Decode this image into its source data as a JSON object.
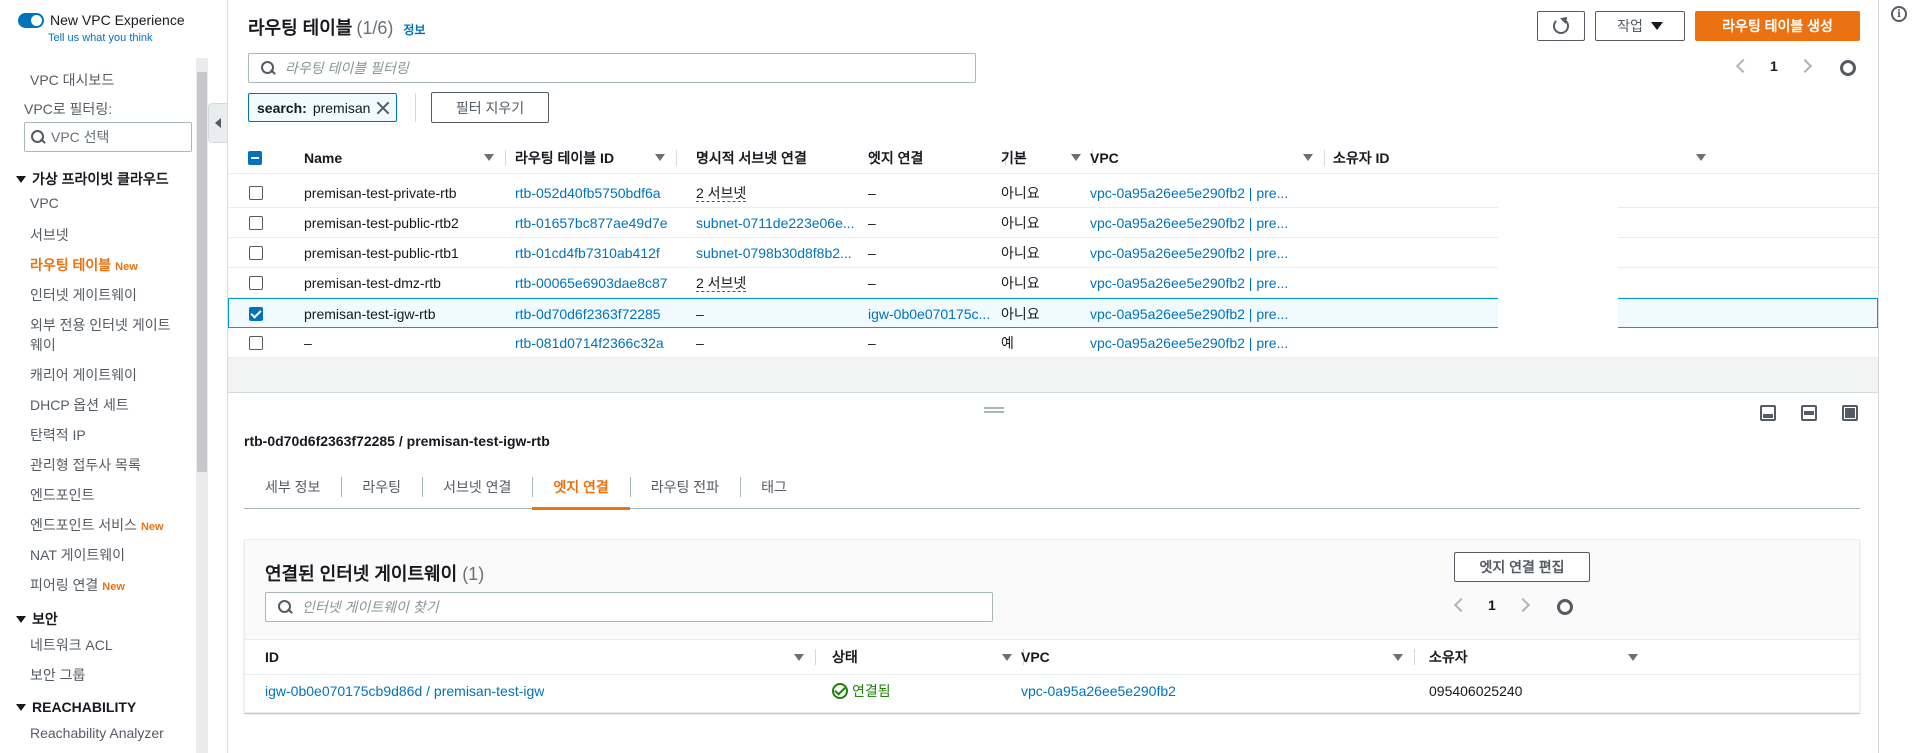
{
  "sidebar": {
    "experience_label": "New VPC Experience",
    "experience_sub": "Tell us what you think",
    "dashboard": "VPC 대시보드",
    "filter_label": "VPC로 필터링:",
    "filter_placeholder": "VPC 선택",
    "section_vpc": "가상 프라이빗 클라우드",
    "items_vpc": [
      {
        "label": "VPC"
      },
      {
        "label": "서브넷"
      },
      {
        "label": "라우팅 테이블",
        "badge": "New"
      },
      {
        "label": "인터넷 게이트웨이"
      },
      {
        "label": "외부 전용 인터넷 게이트",
        "label2": "웨이"
      },
      {
        "label": "캐리어 게이트웨이"
      },
      {
        "label": "DHCP 옵션 세트"
      },
      {
        "label": "탄력적 IP"
      },
      {
        "label": "관리형 접두사 목록"
      },
      {
        "label": "엔드포인트"
      },
      {
        "label": "엔드포인트 서비스",
        "badge": "New"
      },
      {
        "label": "NAT 게이트웨이"
      },
      {
        "label": "피어링 연결",
        "badge": "New"
      }
    ],
    "section_security": "보안",
    "items_security": [
      {
        "label": "네트워크 ACL"
      },
      {
        "label": "보안 그룹"
      }
    ],
    "section_reach": "REACHABILITY",
    "items_reach": [
      {
        "label": "Reachability Analyzer"
      }
    ]
  },
  "header": {
    "title": "라우팅 테이블",
    "count": "(1/6)",
    "info": "정보",
    "actions_label": "작업",
    "create_label": "라우팅 테이블 생성",
    "filter_placeholder": "라우팅 테이블 필터링",
    "page": "1",
    "token_key": "search:",
    "token_value": "premisan",
    "clear_label": "필터 지우기"
  },
  "table": {
    "columns": [
      "Name",
      "라우팅 테이블 ID",
      "명시적 서브넷 연결",
      "엣지 연결",
      "기본",
      "VPC",
      "소유자 ID"
    ],
    "rows": [
      {
        "name": "premisan-test-private-rtb",
        "id": "rtb-052d40fb5750bdf6a",
        "subnet": "2 서브넷",
        "edge": "–",
        "main": "아니요",
        "vpc": "vpc-0a95a26ee5e290fb2 | pre...",
        "checked": false
      },
      {
        "name": "premisan-test-public-rtb2",
        "id": "rtb-01657bc877ae49d7e",
        "subnet": "subnet-0711de223e06e...",
        "edge": "–",
        "main": "아니요",
        "vpc": "vpc-0a95a26ee5e290fb2 | pre...",
        "checked": false
      },
      {
        "name": "premisan-test-public-rtb1",
        "id": "rtb-01cd4fb7310ab412f",
        "subnet": "subnet-0798b30d8f8b2...",
        "edge": "–",
        "main": "아니요",
        "vpc": "vpc-0a95a26ee5e290fb2 | pre...",
        "checked": false
      },
      {
        "name": "premisan-test-dmz-rtb",
        "id": "rtb-00065e6903dae8c87",
        "subnet": "2 서브넷",
        "edge": "–",
        "main": "아니요",
        "vpc": "vpc-0a95a26ee5e290fb2 | pre...",
        "checked": false
      },
      {
        "name": "premisan-test-igw-rtb",
        "id": "rtb-0d70d6f2363f72285",
        "subnet": "–",
        "edge": "igw-0b0e070175c...",
        "main": "아니요",
        "vpc": "vpc-0a95a26ee5e290fb2 | pre...",
        "checked": true
      },
      {
        "name": "–",
        "id": "rtb-081d0714f2366c32a",
        "subnet": "–",
        "edge": "–",
        "main": "예",
        "vpc": "vpc-0a95a26ee5e290fb2 | pre...",
        "checked": false
      }
    ]
  },
  "detail": {
    "title": "rtb-0d70d6f2363f72285 / premisan-test-igw-rtb",
    "tabs": [
      "세부 정보",
      "라우팅",
      "서브넷 연결",
      "엣지 연결",
      "라우팅 전파",
      "태그"
    ],
    "active_tab": "엣지 연결",
    "container_title": "연결된 인터넷 게이트웨이",
    "container_count": "(1)",
    "edit_label": "엣지 연결 편집",
    "search_placeholder": "인터넷 게이트웨이 찾기",
    "page": "1",
    "columns": [
      "ID",
      "상태",
      "VPC",
      "소유자"
    ],
    "row": {
      "id": "igw-0b0e070175cb9d86d / premisan-test-igw",
      "state": "연결됨",
      "vpc": "vpc-0a95a26ee5e290fb2",
      "owner": "095406025240"
    }
  },
  "colors": {
    "accent": "#ec7211",
    "link": "#0073bb",
    "success": "#1d8102"
  },
  "icons": [
    "toggle-icon",
    "search-icon",
    "refresh-icon",
    "caret-down-icon",
    "chevron-left-icon",
    "chevron-right-icon",
    "gear-icon",
    "close-icon",
    "status-success-icon",
    "info-icon"
  ]
}
